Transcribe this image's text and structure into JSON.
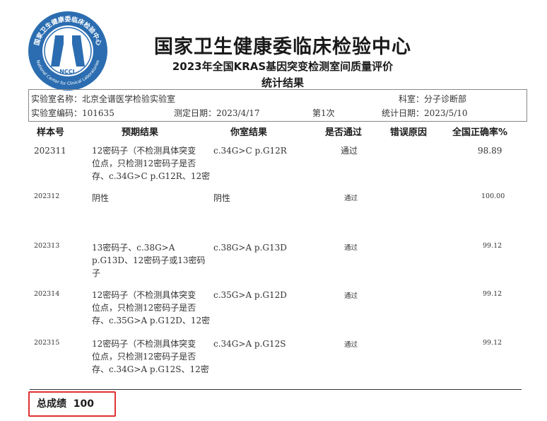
{
  "header": {
    "logo_name": "national-center-for-clinical-laboratories-logo",
    "logo_text": "国家卫生健康委临床检验中心",
    "logo_text_en": "National Center for Clinical Laboratories",
    "logo_letters": "NCCL",
    "title": "国家卫生健康委临床检验中心",
    "subtitle": "2023年全国KRAS基因突变检测室间质量评价",
    "subtitle2": "统计结果"
  },
  "info": {
    "lab_name_label": "实验室名称：",
    "lab_name": "北京全谱医学检验实验室",
    "department_label": "科室：",
    "department": "分子诊断部",
    "lab_code_label": "实验室编码：",
    "lab_code": "101635",
    "test_date_label": "测定日期：",
    "test_date": "2023/4/17",
    "round": "第1次",
    "stat_date_label": "统计日期：",
    "stat_date": "2023/5/10"
  },
  "table": {
    "headers": [
      "样本号",
      "预期结果",
      "你室结果",
      "是否通过",
      "错误原因",
      "全国正确率%"
    ],
    "rows": [
      {
        "sample": "202311",
        "expected": [
          "12密码子（不检测具体突变",
          "位点，只检测12密码子是否",
          "存、c.34G>C p.G12R、12密"
        ],
        "result": "c.34G>C p.G12R",
        "pass": "通过",
        "reason": "",
        "rate": "98.89"
      },
      {
        "sample": "202312",
        "expected": [
          "阴性"
        ],
        "result": "阴性",
        "pass": "通过",
        "reason": "",
        "rate": "100.00"
      },
      {
        "sample": "202313",
        "expected": [
          "13密码子、c.38G>A",
          "p.G13D、12密码子或13密码",
          "子"
        ],
        "result": "c.38G>A p.G13D",
        "pass": "通过",
        "reason": "",
        "rate": "99.12"
      },
      {
        "sample": "202314",
        "expected": [
          "12密码子（不检测具体突变",
          "位点，只检测12密码子是否",
          "存、c.35G>A p.G12D、12密"
        ],
        "result": "c.35G>A p.G12D",
        "pass": "通过",
        "reason": "",
        "rate": "99.12"
      },
      {
        "sample": "202315",
        "expected": [
          "12密码子（不检测具体突变",
          "位点，只检测12密码子是否",
          "存、c.34G>A p.G12S、12密"
        ],
        "result": "c.34G>A p.G12S",
        "pass": "通过",
        "reason": "",
        "rate": "99.12"
      }
    ]
  },
  "summary": {
    "total_label": "总成绩",
    "total_score": "100",
    "highlight_color": "#e03030"
  }
}
